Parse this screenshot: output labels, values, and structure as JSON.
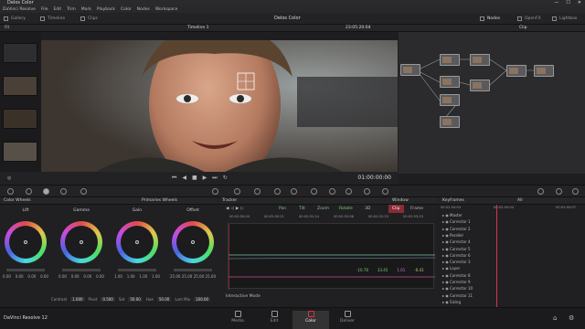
{
  "window": {
    "title": "Delos Color",
    "controls": [
      "—",
      "☐",
      "✕"
    ]
  },
  "menu": [
    "DaVinci Resolve",
    "File",
    "Edit",
    "Trim",
    "Mark",
    "Playback",
    "Color",
    "Nodes",
    "Workspace"
  ],
  "pagebar": {
    "gallery": "Gallery",
    "timeline": "Timeline",
    "clips": "Clips",
    "project": "Delos Color",
    "nodes": "Nodes",
    "openfx": "OpenFX",
    "lightbox": "Lightbox"
  },
  "viewerbar": {
    "fit": "Fit",
    "timeline_name": "Timeline 1",
    "timecode": "23:05:20:04",
    "clip": "Clip"
  },
  "transport": {
    "timecode": "01:00:00:00"
  },
  "color_wheels": {
    "title": "Color Wheels",
    "mode": "Primaries Wheels",
    "wheels": [
      {
        "label": "Lift",
        "values": [
          "0.00",
          "0.00",
          "0.00",
          "0.00"
        ]
      },
      {
        "label": "Gamma",
        "values": [
          "0.00",
          "0.00",
          "0.00",
          "0.00"
        ]
      },
      {
        "label": "Gain",
        "values": [
          "1.00",
          "1.00",
          "1.00",
          "1.00"
        ]
      },
      {
        "label": "Offset",
        "values": [
          "25.00",
          "25.00",
          "25.00",
          "25.00"
        ]
      }
    ],
    "footer": {
      "contrast_label": "Contrast",
      "contrast": "1.000",
      "pivot_label": "Pivot",
      "pivot": "0.500",
      "sat_label": "Sat",
      "sat": "50.00",
      "hue_label": "Hue",
      "hue": "50.00",
      "lummix_label": "Lum Mix",
      "lummix": "100.00"
    }
  },
  "tracker": {
    "title": "Tracker",
    "window": "Window",
    "options": [
      "Pan",
      "Tilt",
      "Zoom",
      "Rotate",
      "3D"
    ],
    "clip_btn": "Clip",
    "frame_btn": "Frame",
    "ruler": [
      "00:02:50:04",
      "00:02:50:21",
      "00:02:51:14",
      "00:02:52:06",
      "00:02:52:23",
      "00:02:53:15"
    ],
    "readouts": [
      "-10.78",
      "33.45",
      "1.01",
      "-0.41"
    ],
    "interactive_mode": "Interactive Mode"
  },
  "keyframes": {
    "title": "Keyframes",
    "all": "All",
    "tc1": "00:02:50:04",
    "tc2": "00:02:50:04",
    "tc3": "00:02:50:07",
    "rows": [
      "Master",
      "Corrector 1",
      "Corrector 2",
      "Parallel",
      "Corrector 4",
      "Corrector 5",
      "Corrector 6",
      "Corrector 3",
      "Layer",
      "Corrector 8",
      "Corrector 9",
      "Corrector 10",
      "Corrector 11",
      "Sizing"
    ]
  },
  "footer": {
    "app": "DaVinci Resolve 12",
    "pages": [
      "Media",
      "Edit",
      "Color",
      "Deliver"
    ],
    "active": "Color"
  },
  "colors": {
    "accent": "#d8334a",
    "bg": "#1e1e20"
  }
}
